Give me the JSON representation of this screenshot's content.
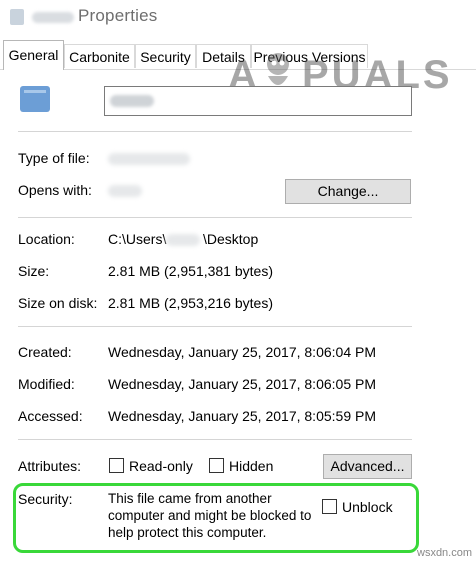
{
  "window": {
    "title": "Properties",
    "icon": "file-icon"
  },
  "tabs": [
    {
      "label": "General",
      "active": true
    },
    {
      "label": "Carbonite"
    },
    {
      "label": "Security"
    },
    {
      "label": "Details"
    },
    {
      "label": "Previous Versions"
    }
  ],
  "general": {
    "type_of_file_label": "Type of file:",
    "opens_with_label": "Opens with:",
    "change_button": "Change...",
    "location_label": "Location:",
    "location_value": "C:\\Users\\",
    "location_value_suffix": "\\Desktop",
    "size_label": "Size:",
    "size_value": "2.81 MB (2,951,381 bytes)",
    "size_on_disk_label": "Size on disk:",
    "size_on_disk_value": "2.81 MB (2,953,216 bytes)",
    "created_label": "Created:",
    "created_value": "Wednesday, January 25, 2017, 8:06:04 PM",
    "modified_label": "Modified:",
    "modified_value": "Wednesday, January 25, 2017, 8:06:05 PM",
    "accessed_label": "Accessed:",
    "accessed_value": "Wednesday, January 25, 2017, 8:05:59 PM",
    "attributes_label": "Attributes:",
    "readonly_label": "Read-only",
    "hidden_label": "Hidden",
    "advanced_button": "Advanced...",
    "security_label": "Security:",
    "security_line1": "This file came from another",
    "security_line2": "computer and might be blocked to",
    "security_line3": "help protect this computer.",
    "unblock_label": "Unblock"
  },
  "watermark": {
    "left": "A",
    "right": "PUALS",
    "site": "wsxdn.com"
  },
  "colors": {
    "highlight": "#39d839",
    "title_text": "#6e6e6e",
    "button_bg": "#e1e1e1"
  }
}
